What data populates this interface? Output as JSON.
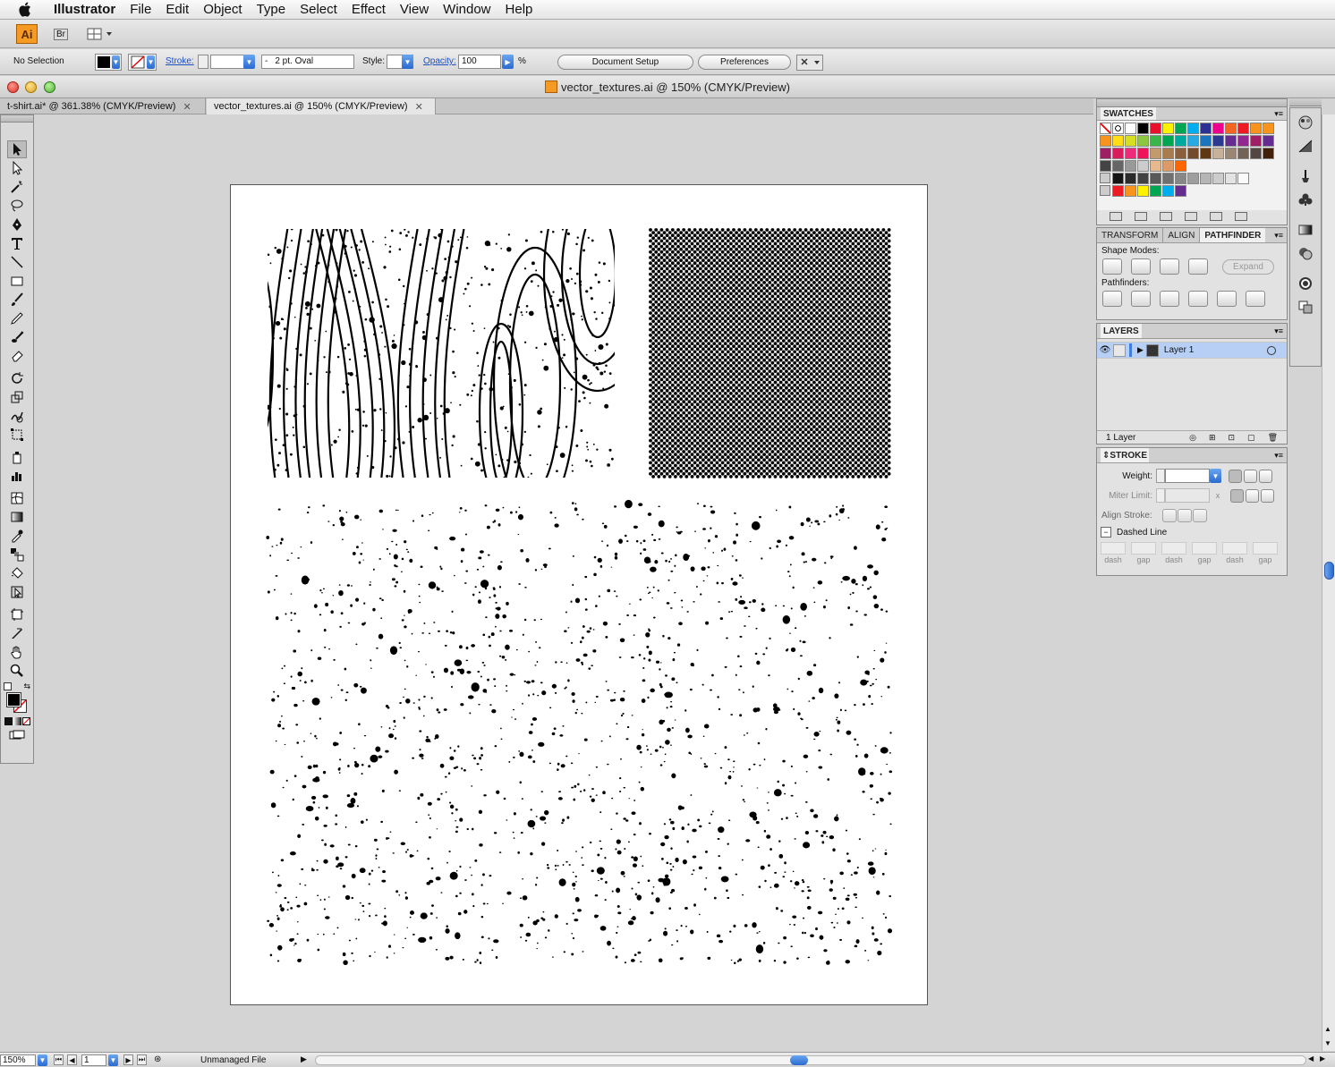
{
  "menubar": {
    "app": "Illustrator",
    "items": [
      "File",
      "Edit",
      "Object",
      "Type",
      "Select",
      "Effect",
      "View",
      "Window",
      "Help"
    ]
  },
  "appbar": {
    "logo": "Ai",
    "bridge": "Br"
  },
  "control": {
    "selection": "No Selection",
    "stroke_label": "Stroke:",
    "brush": "2 pt. Oval",
    "brush_dash": "-",
    "style_label": "Style:",
    "opacity_label": "Opacity:",
    "opacity_value": "100",
    "percent": "%",
    "document_setup": "Document Setup",
    "preferences": "Preferences"
  },
  "window": {
    "title": "vector_textures.ai @ 150% (CMYK/Preview)"
  },
  "tabs": [
    {
      "label": "t-shirt.ai* @ 361.38% (CMYK/Preview)",
      "active": false
    },
    {
      "label": "vector_textures.ai @ 150% (CMYK/Preview)",
      "active": true
    }
  ],
  "swatches": {
    "title": "SWATCHES"
  },
  "pathfinder": {
    "tabs": [
      "TRANSFORM",
      "ALIGN",
      "PATHFINDER"
    ],
    "shape_modes": "Shape Modes:",
    "expand": "Expand",
    "pathfinders": "Pathfinders:"
  },
  "layers": {
    "title": "LAYERS",
    "layer_name": "Layer 1",
    "count": "1 Layer"
  },
  "stroke": {
    "title": "STROKE",
    "weight": "Weight:",
    "miter": "Miter Limit:",
    "miter_x": "x",
    "align": "Align Stroke:",
    "dashed": "Dashed Line",
    "dash_labels": [
      "dash",
      "gap",
      "dash",
      "gap",
      "dash",
      "gap"
    ]
  },
  "status": {
    "zoom": "150%",
    "page": "1",
    "info": "Unmanaged File"
  },
  "colors": {
    "accent": "#3d7ee0",
    "ai_orange": "#f59a23",
    "layer_select": "#b7cef5"
  }
}
